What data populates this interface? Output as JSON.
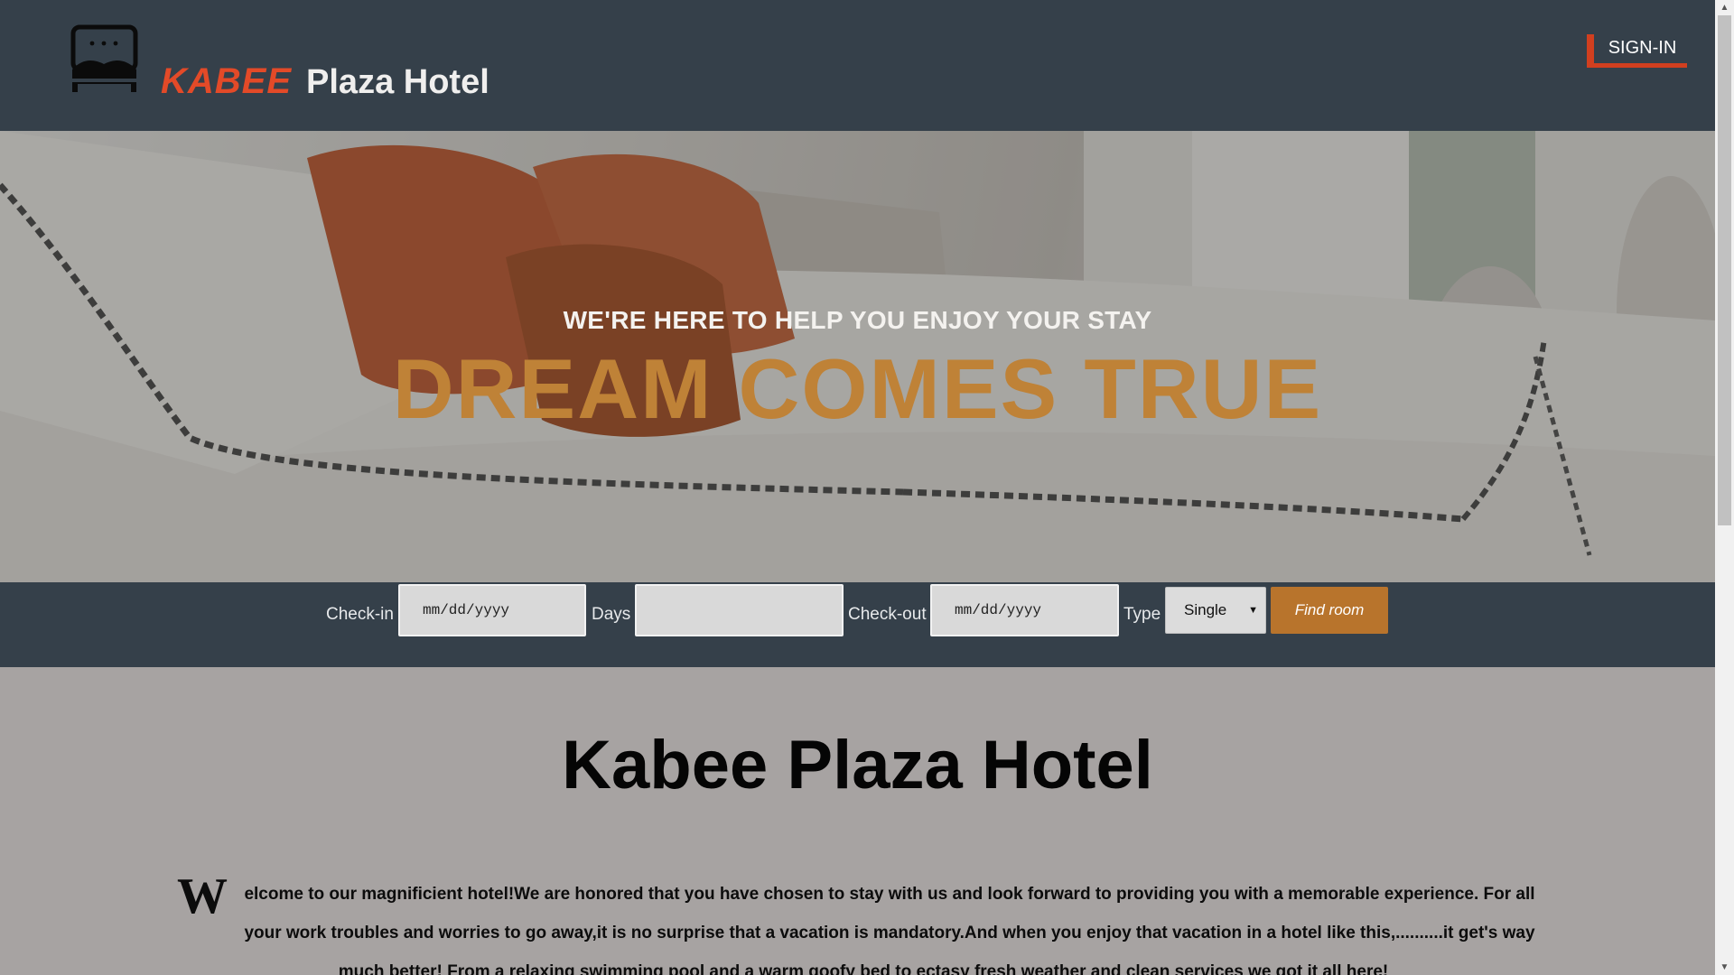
{
  "header": {
    "brand_accent": "KABEE",
    "brand_name": "Plaza Hotel",
    "signin_label": "SIGN-IN",
    "logo_icon": "bed-icon"
  },
  "hero": {
    "subtitle": "WE'RE HERE TO HELP YOU ENJOY YOUR STAY",
    "title": "DREAM COMES TRUE",
    "title_color": "#bf8237"
  },
  "booking": {
    "checkin_label": "Check-in",
    "checkin_placeholder": "mm/dd/yyyy",
    "days_label": "Days",
    "days_value": "",
    "checkout_label": "Check-out",
    "checkout_placeholder": "mm/dd/yyyy",
    "type_label": "Type",
    "type_selected": "Single",
    "find_label": "Find room",
    "find_color": "#b8742c"
  },
  "content": {
    "title": "Kabee Plaza Hotel",
    "dropcap": "W",
    "welcome": "elcome to our magnificient hotel!We are honored that you have chosen to stay with us and look forward to providing you with a memorable experience. For all your work troubles and worries to go away,it is no surprise that a vacation is mandatory.And when you enjoy that vacation in a hotel like this,..........it get's way much better! From a relaxing swimming pool and a warm goofy bed to ectasy fresh weather and clean services we got it all here!"
  },
  "colors": {
    "header_bg": "#35404a",
    "accent_red": "#e34a28",
    "content_bg": "#a7a3a2"
  }
}
